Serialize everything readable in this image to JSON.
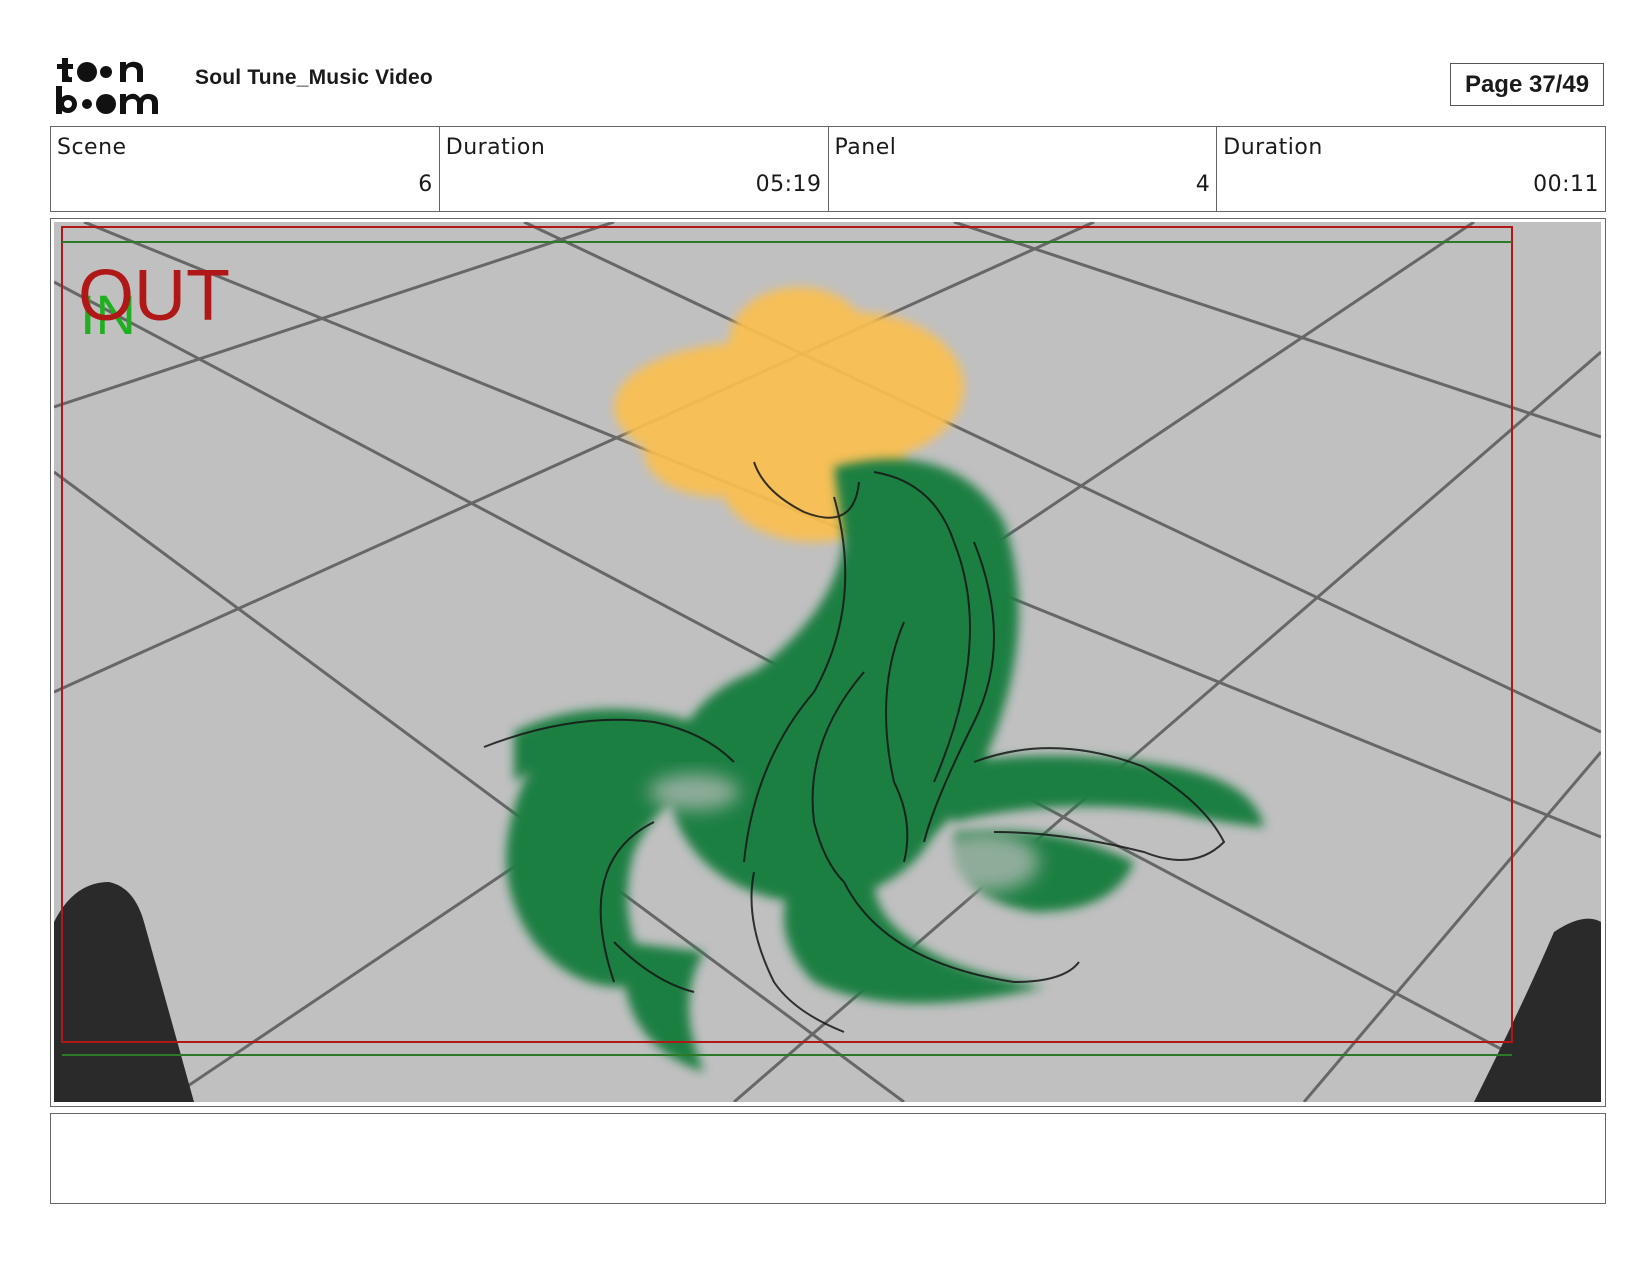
{
  "header": {
    "logo_text_top": "toon",
    "logo_text_bottom": "boom",
    "project_title": "Soul Tune_Music Video",
    "page_indicator": "Page 37/49"
  },
  "info": {
    "scene_label": "Scene",
    "scene_value": "6",
    "scene_duration_label": "Duration",
    "scene_duration_value": "05:19",
    "panel_label": "Panel",
    "panel_value": "4",
    "panel_duration_label": "Duration",
    "panel_duration_value": "00:11"
  },
  "panel": {
    "in_marker": "IN",
    "out_marker": "OUT",
    "colors": {
      "background": "#c0c0c0",
      "plant_green": "#1b7f42",
      "flower_yellow": "#fbbf4f",
      "safe_frame_red": "#b01818",
      "safe_frame_green": "#2a7a2a"
    }
  },
  "notes": {
    "text": ""
  }
}
